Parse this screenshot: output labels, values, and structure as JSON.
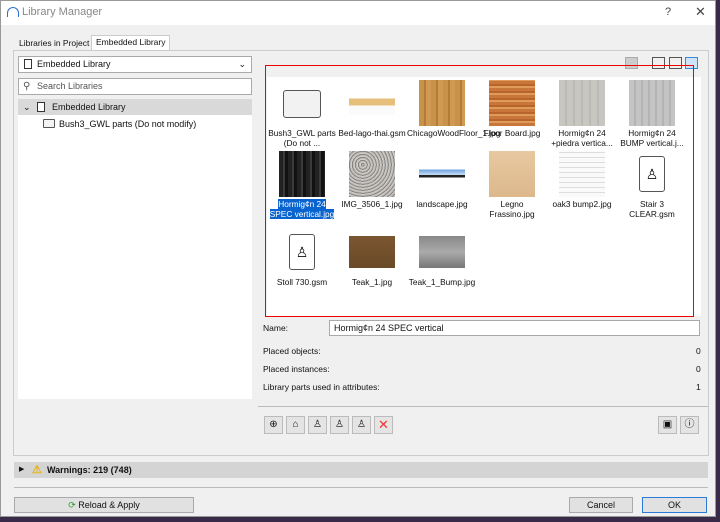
{
  "window": {
    "title": "Library Manager",
    "help": "?",
    "close": "✕"
  },
  "tabs": [
    "Libraries in Project",
    "Embedded Library"
  ],
  "left": {
    "dropdown": "Embedded Library",
    "search_placeholder": "Search Libraries",
    "tree": [
      {
        "label": "Embedded Library"
      },
      {
        "label": "Bush3_GWL parts (Do not modify)"
      }
    ]
  },
  "items": [
    {
      "label": "Bush3_GWL parts (Do not ...",
      "kind": "folder"
    },
    {
      "label": "Bed-lago-thai.gsm",
      "kind": "bed"
    },
    {
      "label": "ChicagoWoodFloor_1.jpg",
      "kind": "wood1"
    },
    {
      "label": "Floor Board.jpg",
      "kind": "wood2"
    },
    {
      "label": "Hormig¢n 24 +piedra vertica...",
      "kind": "gray1"
    },
    {
      "label": "Hormig¢n 24 BUMP vertical.j...",
      "kind": "gray2"
    },
    {
      "label": "Hormig¢n 24 SPEC vertical.jpg",
      "kind": "dark",
      "selected": true
    },
    {
      "label": "IMG_3506_1.jpg",
      "kind": "gravel"
    },
    {
      "label": "landscape.jpg",
      "kind": "land"
    },
    {
      "label": "Legno Frassino.jpg",
      "kind": "light"
    },
    {
      "label": "oak3 bump2.jpg",
      "kind": "white"
    },
    {
      "label": "Stair 3 CLEAR.gsm",
      "kind": "gsm"
    },
    {
      "label": "Stoll 730.gsm",
      "kind": "gsm"
    },
    {
      "label": "Teak_1.jpg",
      "kind": "teak"
    },
    {
      "label": "Teak_1_Bump.jpg",
      "kind": "teakb"
    }
  ],
  "details": {
    "name_label": "Name:",
    "name_value": "Hormig¢n 24 SPEC vertical",
    "rows": [
      {
        "label": "Placed objects:",
        "value": "0"
      },
      {
        "label": "Placed instances:",
        "value": "0"
      },
      {
        "label": "Library parts used in attributes:",
        "value": "1"
      }
    ]
  },
  "warnings": "Warnings: 219 (748)",
  "buttons": {
    "reload": "Reload & Apply",
    "cancel": "Cancel",
    "ok": "OK"
  }
}
